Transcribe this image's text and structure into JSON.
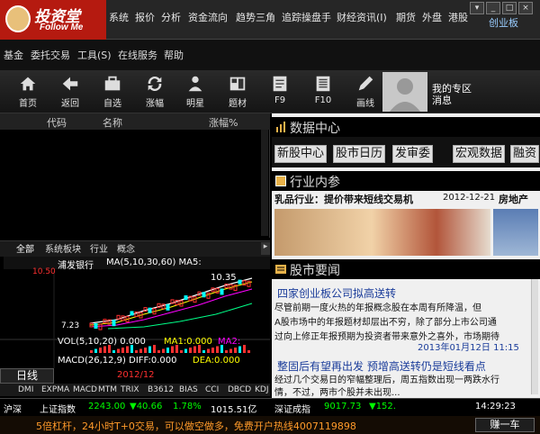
{
  "app": {
    "logo_cn": "投资堂",
    "logo_en": "Follow Me"
  },
  "menu1": [
    "系统",
    "报价",
    "分析",
    "资金流向",
    "趋势三角",
    "追踪操盘手",
    "财经资讯(I)",
    "期货",
    "外盘",
    "港股",
    "创业板"
  ],
  "menu2": [
    "基金",
    "委托交易",
    "工具(S)",
    "在线服务",
    "帮助"
  ],
  "toolbar": [
    "首页",
    "返回",
    "自选",
    "涨幅",
    "明星",
    "题材",
    "F9",
    "F10",
    "画线"
  ],
  "myzone": {
    "title": "我的专区",
    "msg": "消息"
  },
  "list_header": [
    "代码",
    "名称",
    "涨幅%"
  ],
  "left_tabs": [
    "全部",
    "系统板块",
    "行业",
    "概念"
  ],
  "stock": {
    "name": "浦发银行",
    "ma": "MA(5,10,30,60)  MA5:",
    "high": "10.50",
    "peak": "10.35",
    "low": "7.23",
    "vol": "VOL(5,10,20)  0.000",
    "ma1": "MA1:0.000",
    "ma2": "MA2:",
    "macd": "MACD(26,12,9)  DIFF:0.000",
    "dea": "DEA:0.000",
    "period": "日线",
    "date": "2012/12"
  },
  "indicator_tabs": [
    "DMI",
    "EXPMA",
    "MACD",
    "MTM",
    "TRIX",
    "B3612",
    "BIAS",
    "CCI",
    "DBCD",
    "KDJ"
  ],
  "data_center": {
    "title": "数据中心",
    "tabs": [
      "新股中心",
      "股市日历",
      "发审委",
      "宏观数据",
      "融资"
    ]
  },
  "industry": {
    "title": "行业内参",
    "headline": "乳品行业：提价带来短线交易机",
    "date": "2012-12-21",
    "next": "房地产"
  },
  "news": {
    "title": "股市要闻",
    "h1": "四家创业板公司拟高送转",
    "body1": [
      "尽管前期一度火热的年报概念股在本周有所降温，但",
      "A股市场中的年报题材却层出不穷，除了部分上市公司通",
      "过向上修正年报预期为投资者带来意外之喜外，市场期待"
    ],
    "date1": "2013年01月12日 11:15",
    "h2": "整固后有望再出发 预增高送转仍是短线看点",
    "body2": [
      "经过几个交易日的窄幅整理后，周五指数出现一两跌水行",
      "情，不过，两市个股并未出现..."
    ]
  },
  "status": {
    "market": "沪深",
    "index1": "上证指数",
    "v1": "2243.00",
    "c1": "▼40.66",
    "p1": "1.78%",
    "amt1": "1015.51亿",
    "index2": "深证成指",
    "v2": "9017.73",
    "c2": "▼152.",
    "time": "14:29:23"
  },
  "ad": {
    "text": "5倍杠杆，24小时T+0交易，可以做空做多，免费开户热线4007119898",
    "earn": "赚一车"
  },
  "colors": {
    "accent": "#b51a10",
    "up": "#ff3030",
    "down": "#00ff00",
    "yellow": "#ffff00",
    "link": "#1a3c9a"
  }
}
